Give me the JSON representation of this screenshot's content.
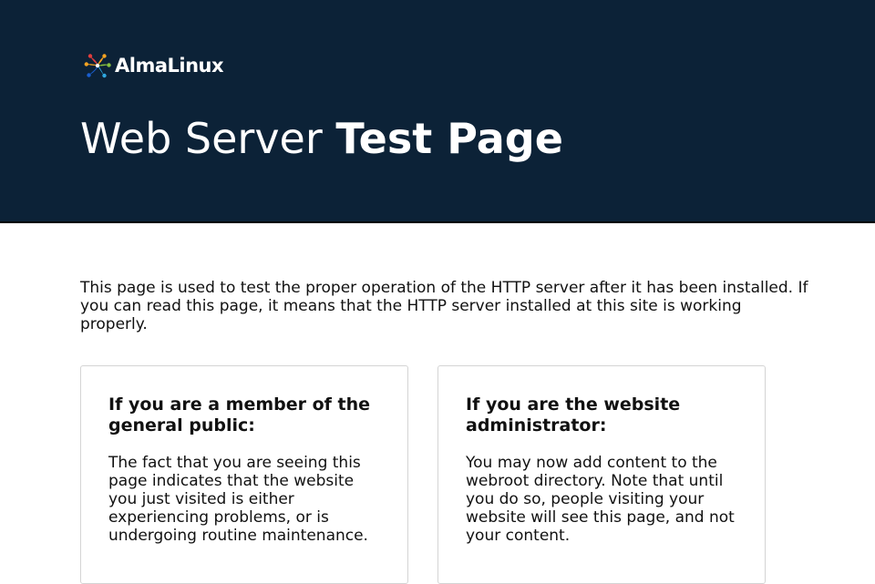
{
  "header": {
    "logo_text": "AlmaLinux",
    "title_light": "Web Server ",
    "title_bold": "Test Page"
  },
  "intro": {
    "text": "This page is used to test the proper operation of the HTTP server after it has been installed. If you can read this page, it means that the HTTP server installed at this site is working properly."
  },
  "cards": [
    {
      "heading": "If you are a member of the general public:",
      "body": "The fact that you are seeing this page indicates that the website you just visited is either experiencing problems, or is undergoing routine maintenance."
    },
    {
      "heading": "If you are the website administrator:",
      "body": "You may now add content to the webroot directory. Note that until you do so, people visiting your website will see this page, and not your content."
    }
  ],
  "colors": {
    "header_bg": "#0c2237",
    "logo_petals": [
      "#e13d3d",
      "#f4a322",
      "#86c03f",
      "#2fa8e0",
      "#1a5fd0"
    ]
  },
  "icons": {
    "logo": "almalinux-logo-icon"
  }
}
